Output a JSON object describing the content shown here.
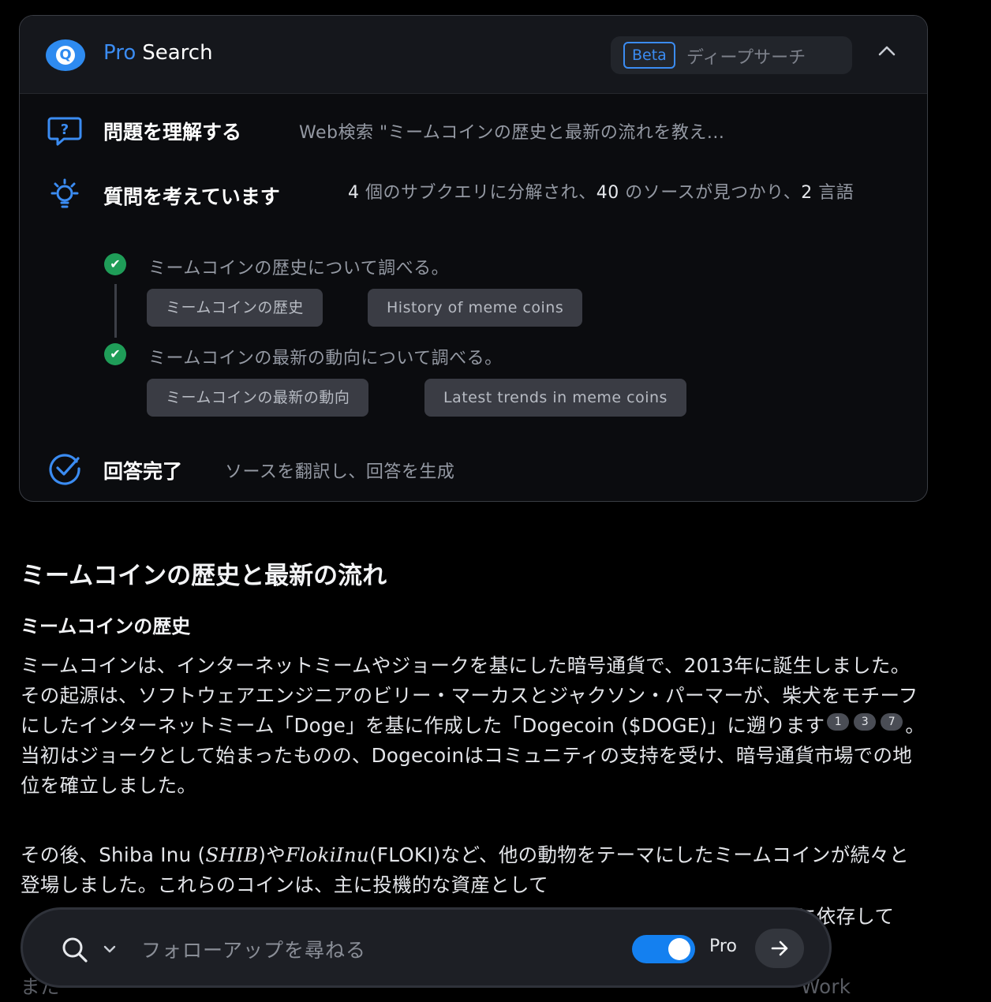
{
  "header": {
    "pro": "Pro",
    "search": "Search",
    "beta": "Beta",
    "mode": "ディープサーチ",
    "collapse_icon": "chevron-up-icon"
  },
  "steps": [
    {
      "title": "問題を理解する",
      "desc": "Web検索 \"ミームコインの歴史と最新の流れを教え..."
    },
    {
      "title": "質問を考えています",
      "desc_a": "4",
      "desc_b": " 個のサブクエリに分解され、",
      "desc_c": "40",
      "desc_d": " のソースが見つかり、",
      "desc_e": "2",
      "desc_f": " 言語"
    },
    {
      "title": "回答完了",
      "desc": "ソースを翻訳し、回答を生成"
    }
  ],
  "subqueries": [
    {
      "label": "ミームコインの歴史について調べる。",
      "chips": [
        "ミームコインの歴史",
        "History of meme coins"
      ]
    },
    {
      "label": "ミームコインの最新の動向について調べる。",
      "chips": [
        "ミームコインの最新の動向",
        "Latest trends in meme coins"
      ]
    }
  ],
  "answer": {
    "title": "ミームコインの歴史と最新の流れ",
    "subtitle": "ミームコインの歴史",
    "p1_a": "ミームコインは、インターネットミームやジョークを基にした暗号通貨で、2013年に誕生しました。その起源は、ソフトウェアエンジニアのビリー・マーカスとジャクソン・パーマーが、柴犬をモチーフにしたインターネットミーム「Doge」を基に作成した「Dogecoin ($DOGE)」に遡ります",
    "cites": [
      "1",
      "3",
      "7"
    ],
    "p1_b": "。当初はジョークとして始まったものの、Dogecoinはコミュニティの支持を受け、暗号通貨市場での地位を確立しました。",
    "p2_a": "その後、Shiba Inu (",
    "p2_math1": "SHIB",
    "p2_b": ")や",
    "p2_math2": "FlokiInu",
    "p2_c": "(FLOKI)など、他の動物をテーマにしたミームコインが続々と登場しました。これらのコインは、主に投機的な資産と",
    "p2_d": "して",
    "p2_e": "に依存して",
    "p3_faded": "また",
    "p3_faded_end": "Work"
  },
  "followup": {
    "placeholder": "フォローアップを尋ねる",
    "pro_label": "Pro",
    "toggle_on": true
  },
  "colors": {
    "accent": "#3b8cf2",
    "success": "#1f9d58",
    "background": "#000000"
  }
}
